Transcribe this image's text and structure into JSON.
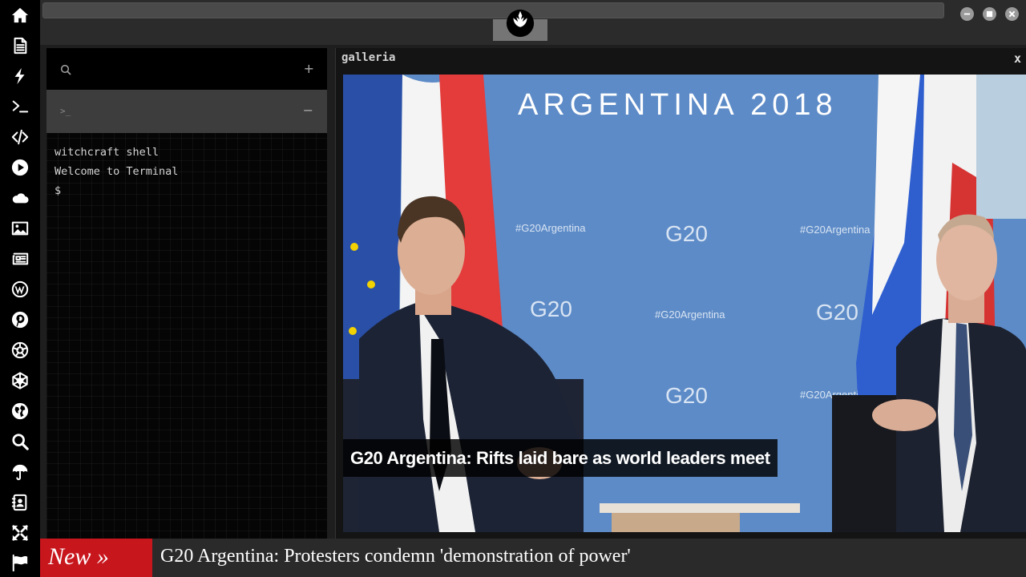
{
  "sidebar": {
    "items": [
      {
        "name": "home-icon"
      },
      {
        "name": "document-icon"
      },
      {
        "name": "bolt-icon"
      },
      {
        "name": "terminal-icon"
      },
      {
        "name": "code-icon"
      },
      {
        "name": "play-icon"
      },
      {
        "name": "cloud-icon"
      },
      {
        "name": "image-icon"
      },
      {
        "name": "newspaper-icon"
      },
      {
        "name": "wordpress-icon"
      },
      {
        "name": "pinterest-icon"
      },
      {
        "name": "aperture-icon"
      },
      {
        "name": "geodesic-icon"
      },
      {
        "name": "globe-icon"
      },
      {
        "name": "search-icon"
      },
      {
        "name": "umbrella-icon"
      },
      {
        "name": "contacts-icon"
      },
      {
        "name": "expand-icon"
      },
      {
        "name": "flag-icon"
      }
    ]
  },
  "topbar": {
    "logo_icon": "rebel-alliance-icon",
    "window_controls": [
      "minimize-icon",
      "maximize-icon",
      "close-icon"
    ]
  },
  "terminal": {
    "search_icon": "search-icon",
    "add_label": "+",
    "tab_prompt_icon": ">_",
    "collapse_label": "−",
    "lines": [
      "witchcraft shell",
      "Welcome to Terminal",
      "$"
    ]
  },
  "galleria": {
    "title": "galleria",
    "close_label": "x",
    "backdrop_banner": "ARGENTINA 2018",
    "backdrop_logo": "G20",
    "backdrop_hashtag": "#G20Argentina",
    "caption": "G20 Argentina: Rifts laid bare as world leaders meet"
  },
  "ticker": {
    "badge": "New »",
    "headline": "G20 Argentina: Protesters condemn 'demonstration of power'"
  },
  "colors": {
    "sidebar_bg": "#000000",
    "app_bg": "#1e1e1e",
    "ticker_badge": "#c8161d",
    "backdrop_blue": "#5d8bc7"
  }
}
